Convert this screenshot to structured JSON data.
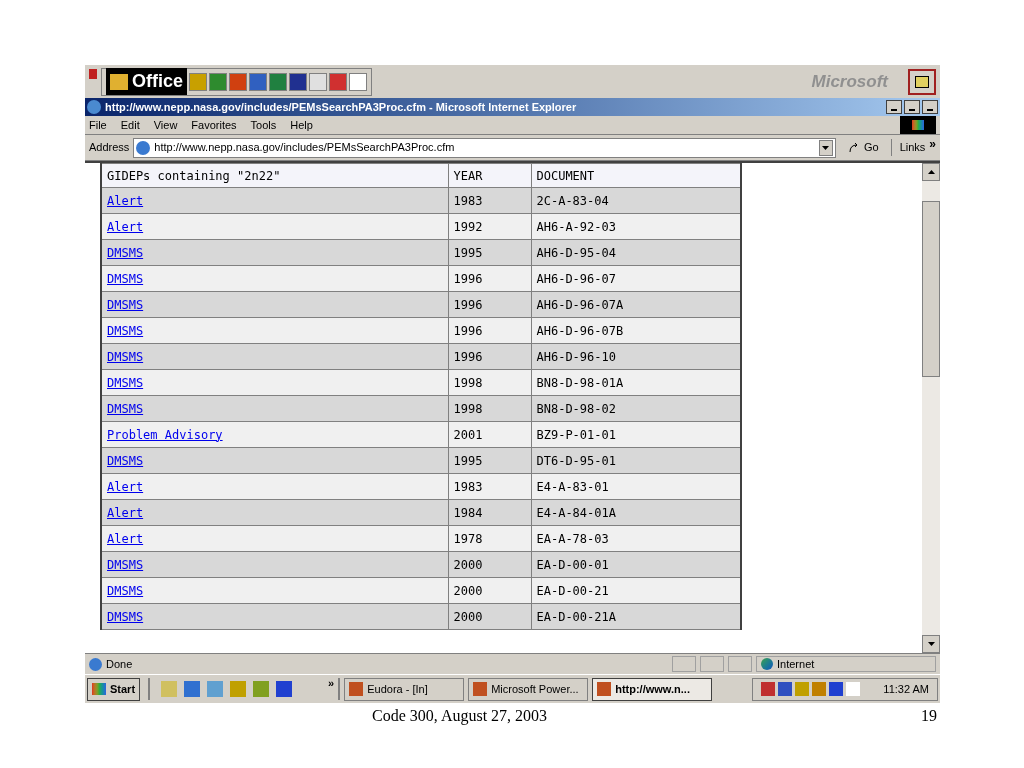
{
  "office_bar": {
    "title": "Office",
    "brand": "Microsoft"
  },
  "window": {
    "title": "http://www.nepp.nasa.gov/includes/PEMsSearchPA3Proc.cfm - Microsoft Internet Explorer"
  },
  "menu": [
    "File",
    "Edit",
    "View",
    "Favorites",
    "Tools",
    "Help"
  ],
  "address": {
    "label": "Address",
    "value": "http://www.nepp.nasa.gov/includes/PEMsSearchPA3Proc.cfm",
    "go": "Go",
    "links": "Links",
    "links_chevron": "»"
  },
  "table": {
    "columns": [
      "GIDEPs containing \"2n22\"",
      "YEAR",
      "DOCUMENT"
    ],
    "rows": [
      {
        "type": "Alert",
        "year": "1983",
        "document": "2C-A-83-04"
      },
      {
        "type": "Alert",
        "year": "1992",
        "document": "AH6-A-92-03"
      },
      {
        "type": "DMSMS",
        "year": "1995",
        "document": "AH6-D-95-04"
      },
      {
        "type": "DMSMS",
        "year": "1996",
        "document": "AH6-D-96-07"
      },
      {
        "type": "DMSMS",
        "year": "1996",
        "document": "AH6-D-96-07A"
      },
      {
        "type": "DMSMS",
        "year": "1996",
        "document": "AH6-D-96-07B"
      },
      {
        "type": "DMSMS",
        "year": "1996",
        "document": "AH6-D-96-10"
      },
      {
        "type": "DMSMS",
        "year": "1998",
        "document": "BN8-D-98-01A"
      },
      {
        "type": "DMSMS",
        "year": "1998",
        "document": "BN8-D-98-02"
      },
      {
        "type": "Problem Advisory",
        "year": "2001",
        "document": "BZ9-P-01-01"
      },
      {
        "type": "DMSMS",
        "year": "1995",
        "document": "DT6-D-95-01"
      },
      {
        "type": "Alert",
        "year": "1983",
        "document": "E4-A-83-01"
      },
      {
        "type": "Alert",
        "year": "1984",
        "document": "E4-A-84-01A"
      },
      {
        "type": "Alert",
        "year": "1978",
        "document": "EA-A-78-03"
      },
      {
        "type": "DMSMS",
        "year": "2000",
        "document": "EA-D-00-01"
      },
      {
        "type": "DMSMS",
        "year": "2000",
        "document": "EA-D-00-21"
      },
      {
        "type": "DMSMS",
        "year": "2000",
        "document": "EA-D-00-21A"
      }
    ]
  },
  "status_bar": {
    "text": "Done",
    "zone": "Internet"
  },
  "taskbar": {
    "start": "Start",
    "chevron": "»",
    "tasks": [
      {
        "label": "Eudora - [In]",
        "selected": false
      },
      {
        "label": "Microsoft Power...",
        "selected": false
      },
      {
        "label": "http://www.n...",
        "selected": true
      }
    ],
    "clock": "11:32 AM"
  },
  "slide_footer": {
    "caption": "Code 300, August 27, 2003",
    "page": "19"
  }
}
